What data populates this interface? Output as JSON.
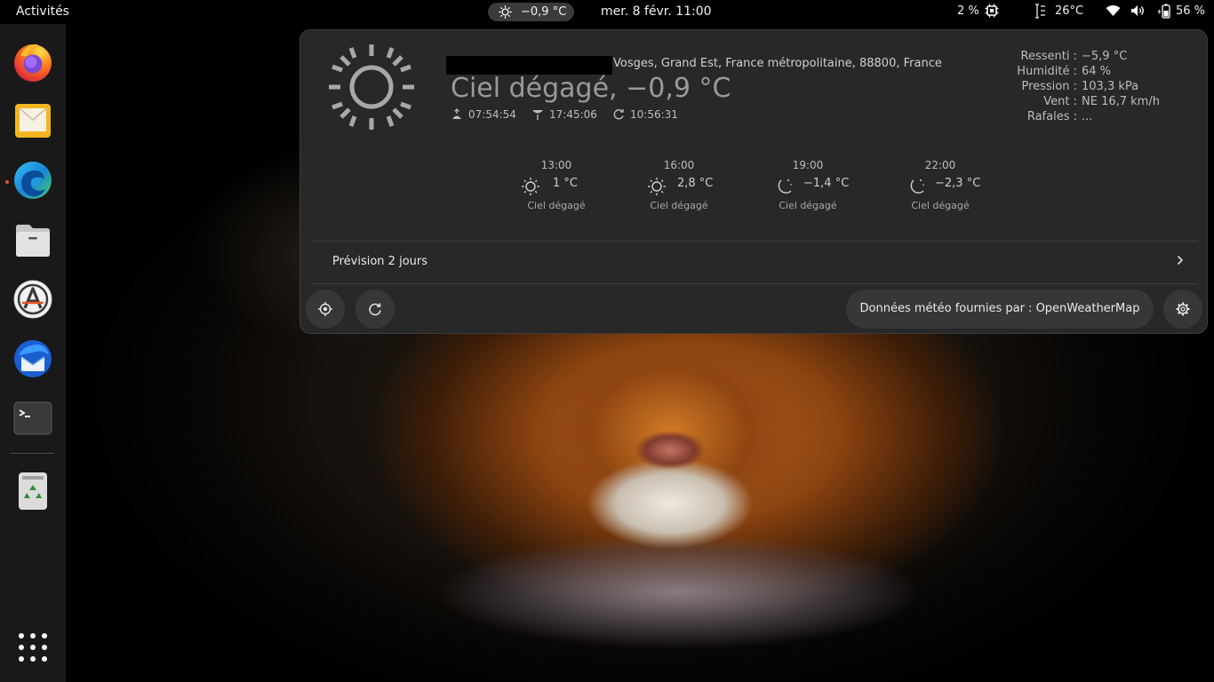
{
  "topbar": {
    "activities": "Activités",
    "weather_indicator": {
      "icon": "sun-icon",
      "temp": "−0,9 °C"
    },
    "clock": "mer. 8 févr.  11:00",
    "cpu_usage": "2 %",
    "cpu_icon": "cpu-icon",
    "temperature": "26°C",
    "battery_pct": "56 %"
  },
  "dock": {
    "apps": [
      "firefox",
      "mail",
      "edge",
      "files",
      "software",
      "thunderbird",
      "terminal",
      "trash"
    ],
    "running": [
      "edge"
    ]
  },
  "weather": {
    "location": "Vosges, Grand Est, France métropolitaine, 88800, France",
    "summary": "Ciel dégagé, −0,9 °C",
    "sunrise": "07:54:54",
    "sunset": "17:45:06",
    "last_update": "10:56:31",
    "details": [
      {
        "label": "Ressenti :",
        "value": "−5,9 °C"
      },
      {
        "label": "Humidité :",
        "value": "64 %"
      },
      {
        "label": "Pression :",
        "value": "103,3 kPa"
      },
      {
        "label": "Vent :",
        "value": "NE 16,7 km/h"
      },
      {
        "label": "Rafales :",
        "value": "..."
      }
    ],
    "hourly": [
      {
        "time": "13:00",
        "icon": "sun-icon",
        "temp": "1 °C",
        "desc": "Ciel dégagé"
      },
      {
        "time": "16:00",
        "icon": "sun-icon",
        "temp": "2,8 °C",
        "desc": "Ciel dégagé"
      },
      {
        "time": "19:00",
        "icon": "moon-stars-icon",
        "temp": "−1,4 °C",
        "desc": "Ciel dégagé"
      },
      {
        "time": "22:00",
        "icon": "moon-stars-icon",
        "temp": "−2,3 °C",
        "desc": "Ciel dégagé"
      }
    ],
    "forecast_label": "Prévision 2 jours",
    "credit": "Données météo fournies par : OpenWeatherMap"
  },
  "colors": {
    "accent_running": "#e95420",
    "popup_bg": "#282828",
    "button_bg": "#373737"
  }
}
